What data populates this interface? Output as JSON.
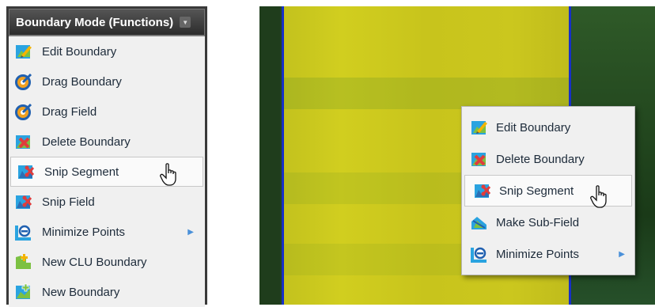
{
  "left_menu": {
    "header": "Boundary Mode (Functions)",
    "items": [
      {
        "label": "Edit Boundary",
        "icon": "edit-boundary-icon"
      },
      {
        "label": "Drag Boundary",
        "icon": "drag-boundary-icon"
      },
      {
        "label": "Drag Field",
        "icon": "drag-field-icon"
      },
      {
        "label": "Delete Boundary",
        "icon": "delete-boundary-icon"
      },
      {
        "label": "Snip Segment",
        "icon": "snip-segment-icon",
        "hovered": true
      },
      {
        "label": "Snip Field",
        "icon": "snip-field-icon"
      },
      {
        "label": "Minimize Points",
        "icon": "minimize-points-icon",
        "submenu": true
      },
      {
        "label": "New CLU Boundary",
        "icon": "new-clu-boundary-icon"
      },
      {
        "label": "New Boundary",
        "icon": "new-boundary-icon"
      }
    ]
  },
  "context_menu": {
    "items": [
      {
        "label": "Edit Boundary",
        "icon": "edit-boundary-icon"
      },
      {
        "label": "Delete Boundary",
        "icon": "delete-boundary-icon"
      },
      {
        "label": "Snip Segment",
        "icon": "snip-segment-icon",
        "hovered": true
      },
      {
        "label": "Make Sub-Field",
        "icon": "make-sub-field-icon"
      },
      {
        "label": "Minimize Points",
        "icon": "minimize-points-icon",
        "submenu": true
      }
    ]
  },
  "colors": {
    "boundary_line": "#1630c8",
    "field_fill": "#cbc71e",
    "submenu_arrow": "#4a90d9"
  }
}
